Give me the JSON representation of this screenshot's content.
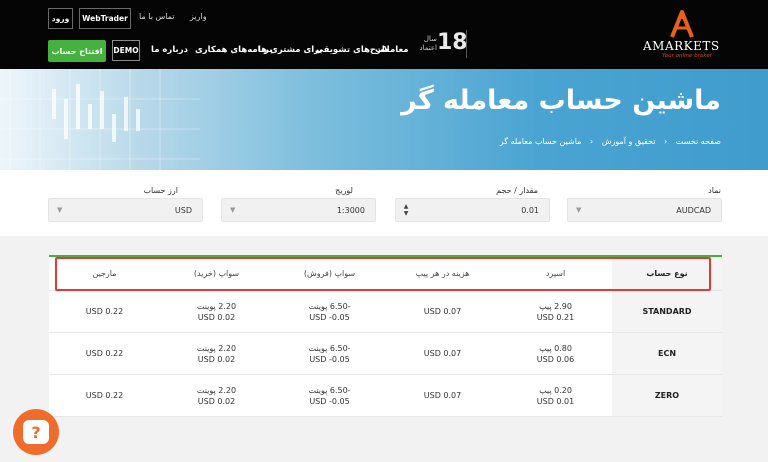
{
  "header": {
    "top_links": {
      "login": "ورود",
      "webtrader": "WebTrader",
      "contact": "تماس با ما",
      "deposit": "واریز"
    },
    "years": {
      "number": "18",
      "label_line1": "سال",
      "label_line2": "اعتماد"
    },
    "nav": [
      "معاملات",
      "طرح‌های تشویقی",
      "برای مشتری ها",
      "برنامه‌های همکاری",
      "درباره ما"
    ],
    "demo_label": "DEMO",
    "open_account_label": "افتتاح حساب",
    "logo": {
      "wordmark": "AMARKETS",
      "tagline": "Your online broker"
    }
  },
  "hero": {
    "title": "ماشین حساب معامله گر",
    "breadcrumb": [
      "صفحه نخست",
      "تحقیق و آموزش",
      "ماشین حساب معامله گر"
    ],
    "breadcrumb_sep": "‹"
  },
  "form": {
    "symbol": {
      "label": "نماد",
      "value": "AUDCAD"
    },
    "volume": {
      "label": "مقدار / حجم",
      "value": "0.01"
    },
    "leverage": {
      "label": "لوریج",
      "value": "1:3000"
    },
    "currency": {
      "label": "ارز حساب",
      "value": "USD"
    }
  },
  "table": {
    "headers": {
      "type": "نوع حساب",
      "spread": "اسپرد",
      "pip_cost": "هزینه در هر پیپ",
      "swap_sell": "سواپ (فروش)",
      "swap_buy": "سواپ (خرید)",
      "margin": "مارجین"
    },
    "rows": [
      {
        "type": "STANDARD",
        "spread1": "2.90 پیپ",
        "spread2": "USD 0.21",
        "pip_cost": "USD 0.07",
        "swap_sell1": "-6.50 پوینت",
        "swap_sell2": "USD -0.05",
        "swap_buy1": "2.20 پوینت",
        "swap_buy2": "USD 0.02",
        "margin": "USD 0.22"
      },
      {
        "type": "ECN",
        "spread1": "0.80 پیپ",
        "spread2": "USD 0.06",
        "pip_cost": "USD 0.07",
        "swap_sell1": "-6.50 پوینت",
        "swap_sell2": "USD -0.05",
        "swap_buy1": "2.20 پوینت",
        "swap_buy2": "USD 0.02",
        "margin": "USD 0.22"
      },
      {
        "type": "ZERO",
        "spread1": "0.20 پیپ",
        "spread2": "USD 0.01",
        "pip_cost": "USD 0.07",
        "swap_sell1": "-6.50 پوینت",
        "swap_sell2": "USD -0.05",
        "swap_buy1": "2.20 پوینت",
        "swap_buy2": "USD 0.02",
        "margin": "USD 0.22"
      }
    ]
  },
  "colors": {
    "brand_orange": "#ef6c2c",
    "green": "#45b23f",
    "highlight_red": "#e53935"
  },
  "icons": {
    "help": "help-question-icon",
    "logo": "amarkets-a-logo-icon"
  }
}
